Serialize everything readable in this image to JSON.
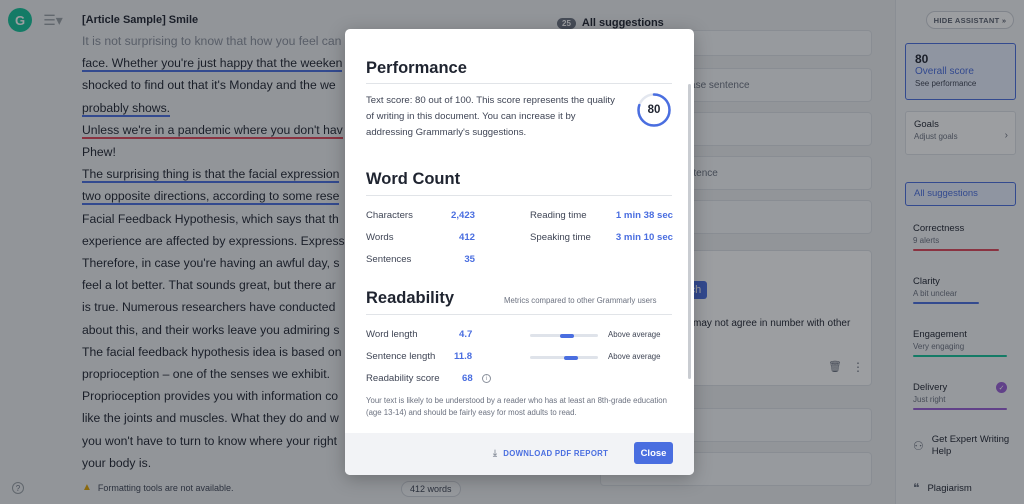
{
  "document": {
    "title": "[Article Sample] Smile",
    "lines": [
      "It is not surprising to know that how you feel can",
      "face. Whether you're just happy that the weeken",
      "shocked to find out that it's Monday and the we",
      "probably shows.",
      "Unless we're in a pandemic where you don't hav",
      "Phew!",
      "The surprising thing is that the facial expression",
      "two opposite directions, according to some rese",
      "Facial Feedback Hypothesis, which says that th",
      "experience are affected by expressions. Express",
      "Therefore, in case you're having an awful day, s",
      "feel a lot better. That sounds great, but there ar",
      "is true. Numerous researchers have conducted",
      "about this, and their works leave you admiring s",
      "The facial feedback hypothesis idea is based on",
      "proprioception – one of the senses we exhibit.",
      "Proprioception provides you with information co",
      "like the joints and muscles. What they do and w",
      "you won't have to turn to know where your right",
      "your body is.",
      "The facial expressions you are to interpret and"
    ],
    "footer_warning": "Formatting tools are not available.",
    "word_count_pill": "412 words"
  },
  "suggestions": {
    "count": "25",
    "header": "All suggestions",
    "cards": [
      "na",
      "t the fa...  ·  Rephrase sentence",
      "ce",
      "Complete the sentence",
      "ding",
      "entence",
      "rase"
    ],
    "chip": "rch",
    "detail": "may not agree in number with other"
  },
  "sidebar": {
    "hide_label": "HIDE ASSISTANT",
    "score": "80",
    "score_label": "Overall score",
    "score_sub": "See performance",
    "goals_label": "Goals",
    "goals_sub": "Adjust goals",
    "all_label": "All suggestions",
    "categories": [
      {
        "label": "Correctness",
        "sub": "9 alerts",
        "color": "#e0485a",
        "level": 0.92
      },
      {
        "label": "Clarity",
        "sub": "A bit unclear",
        "color": "#4a6ee0",
        "level": 0.7
      },
      {
        "label": "Engagement",
        "sub": "Very engaging",
        "color": "#15c39a",
        "level": 1.0
      },
      {
        "label": "Delivery",
        "sub": "Just right",
        "color": "#9a5fd6",
        "level": 1.0
      }
    ],
    "expert_label": "Get Expert Writing Help",
    "plagiarism_label": "Plagiarism"
  },
  "modal": {
    "performance_title": "Performance",
    "performance_text": "Text score: 80 out of 100. This score represents the quality of writing in this document. You can increase it by addressing Grammarly's suggestions.",
    "score": "80",
    "score_fraction": 0.8,
    "wordcount_title": "Word Count",
    "wordcount": {
      "characters_label": "Characters",
      "characters": "2,423",
      "words_label": "Words",
      "words": "412",
      "sentences_label": "Sentences",
      "sentences": "35",
      "reading_label": "Reading time",
      "reading": "1 min 38 sec",
      "speaking_label": "Speaking time",
      "speaking": "3 min 10 sec"
    },
    "readability_title": "Readability",
    "readability_note": "Metrics compared to other Grammarly users",
    "readability": {
      "word_length_label": "Word length",
      "word_length": "4.7",
      "word_length_compare": "Above average",
      "word_length_level": 0.55,
      "sentence_length_label": "Sentence length",
      "sentence_length": "11.8",
      "sentence_length_compare": "Above average",
      "sentence_length_level": 0.6,
      "score_label": "Readability score",
      "score": "68"
    },
    "readability_desc": "Your text is likely to be understood by a reader who has at least an 8th-grade education (age 13-14) and should be fairly easy for most adults to read.",
    "download_label": "DOWNLOAD PDF REPORT",
    "close_label": "Close"
  }
}
